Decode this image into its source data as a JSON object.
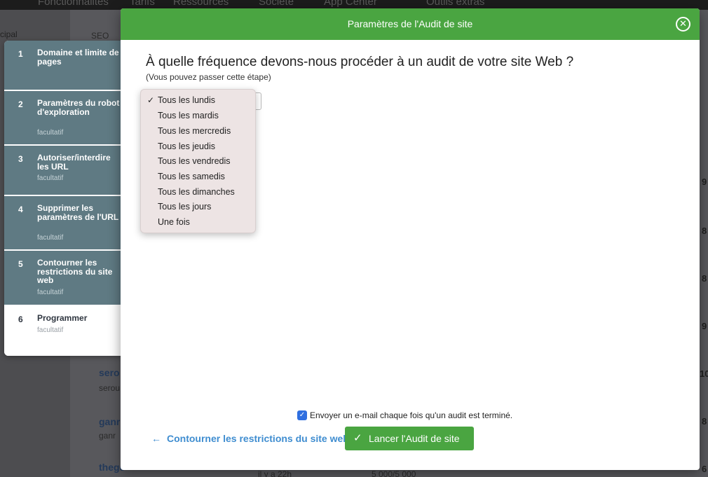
{
  "background": {
    "nav": [
      "Fonctionnalités",
      "Tarifs",
      "Ressources",
      "Société",
      "App Center",
      "Outils extras"
    ],
    "sidebar_label": "cipal",
    "breadcrumb": "SEO",
    "rows": [
      {
        "link": "sero",
        "sub": "serou"
      },
      {
        "link": "ganr",
        "sub": "ganr"
      },
      {
        "link": "thege"
      }
    ],
    "right_digits": [
      "9",
      "8",
      "8",
      "9",
      "10",
      "8",
      "6"
    ],
    "bottom_texts": [
      "il y a 22h",
      "5 000/5 000"
    ]
  },
  "steps": [
    {
      "num": "1",
      "title": "Domaine et limite de pages",
      "subtitle": ""
    },
    {
      "num": "2",
      "title": "Paramètres du robot d'exploration",
      "subtitle": "facultatif"
    },
    {
      "num": "3",
      "title": "Autoriser/interdire les URL",
      "subtitle": "facultatif"
    },
    {
      "num": "4",
      "title": "Supprimer les paramètres de l'URL",
      "subtitle": "facultatif"
    },
    {
      "num": "5",
      "title": "Contourner les restrictions du site web",
      "subtitle": "facultatif"
    },
    {
      "num": "6",
      "title": "Programmer",
      "subtitle": "facultatif"
    }
  ],
  "modal": {
    "title": "Paramètres de l'Audit de site",
    "close_icon": "close-circle-icon",
    "question": "À quelle fréquence devons-nous procéder à un audit de votre site Web ?",
    "skip_note": "(Vous pouvez passer cette étape)",
    "frequency": {
      "selected": "Tous les lundis",
      "options": [
        "Tous les lundis",
        "Tous les mardis",
        "Tous les mercredis",
        "Tous les jeudis",
        "Tous les vendredis",
        "Tous les samedis",
        "Tous les dimanches",
        "Tous les jours",
        "Une fois"
      ]
    },
    "email_checkbox": {
      "checked": true,
      "label": "Envoyer un e-mail chaque fois qu'un audit est terminé."
    },
    "back_link": "Contourner les restrictions du site web",
    "launch_button": "Lancer l'Audit de site"
  },
  "colors": {
    "accent_green": "#4aa541",
    "step_inactive": "#5f7a83",
    "link_blue": "#3f8dd0",
    "checkbox_blue": "#2f6fe0",
    "dropdown_bg": "#ede4e4"
  }
}
